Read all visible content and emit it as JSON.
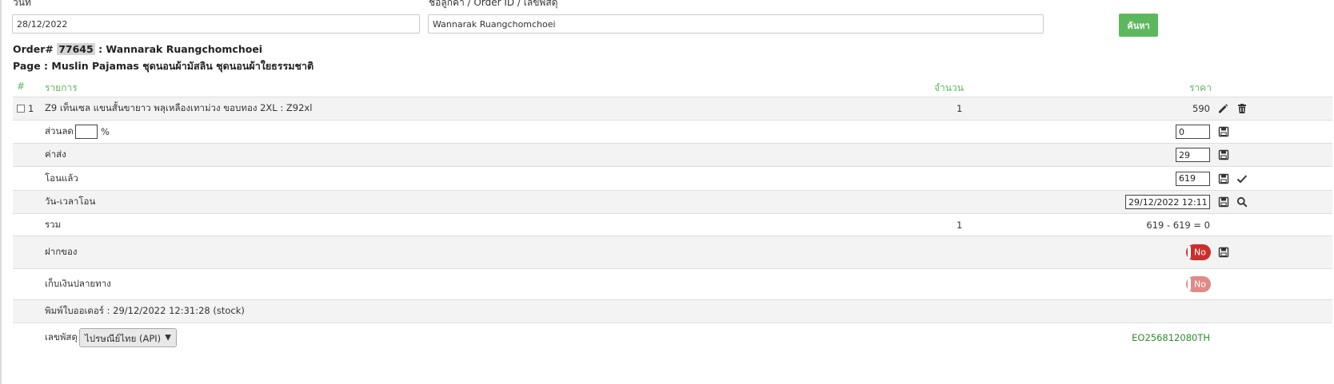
{
  "search": {
    "date_label": "วันที่",
    "date_value": "28/12/2022",
    "query_label": "ชื่อลูกค้า / Order ID / เลขพัสดุ",
    "query_value": "Wannarak Ruangchomchoei",
    "button_label": "ค้นหา"
  },
  "order": {
    "prefix": "Order# ",
    "id": "77645",
    "customer": " : Wannarak Ruangchomchoei",
    "page": "Page : Muslin Pajamas ชุดนอนผ้ามัสลิน ชุดนอนผ้าใยธรรมชาติ"
  },
  "table": {
    "headers": {
      "index": "#",
      "item": "รายการ",
      "qty": "จำนวน",
      "price": "ราคา"
    },
    "item": {
      "index": "1",
      "name": "Z9 เท็นเซล แขนสั้นขายาว พลุเหลืองเทาม่วง ขอบทอง 2XL : Z92xl",
      "qty": "1",
      "price": "590"
    },
    "discount": {
      "label": "ส่วนลด",
      "unit": "%",
      "percent_value": "",
      "value": "0"
    },
    "shipping": {
      "label": "ค่าส่ง",
      "value": "29"
    },
    "transferred": {
      "label": "โอนแล้ว",
      "value": "619"
    },
    "transfer_time": {
      "label": "วัน-เวลาโอน",
      "value": "29/12/2022 12:11"
    },
    "total": {
      "label": "รวม",
      "qty": "1",
      "value": "619 - 619 = 0"
    },
    "deposit": {
      "label": "ฝากของ",
      "toggle": "No"
    },
    "cod": {
      "label": "เก็บเงินปลายทาง",
      "toggle": "No"
    },
    "printed": {
      "text": "พิมพ์ใบออเดอร์ : 29/12/2022 12:31:28 (stock)"
    },
    "tracking": {
      "label": "เลขพัสดุ",
      "carrier": "ไปรษณีย์ไทย (API)",
      "number": "EO256812080TH"
    }
  },
  "colors": {
    "accent": "#5cb85c",
    "danger": "#c9302c",
    "tracking": "#2e8b2e"
  }
}
